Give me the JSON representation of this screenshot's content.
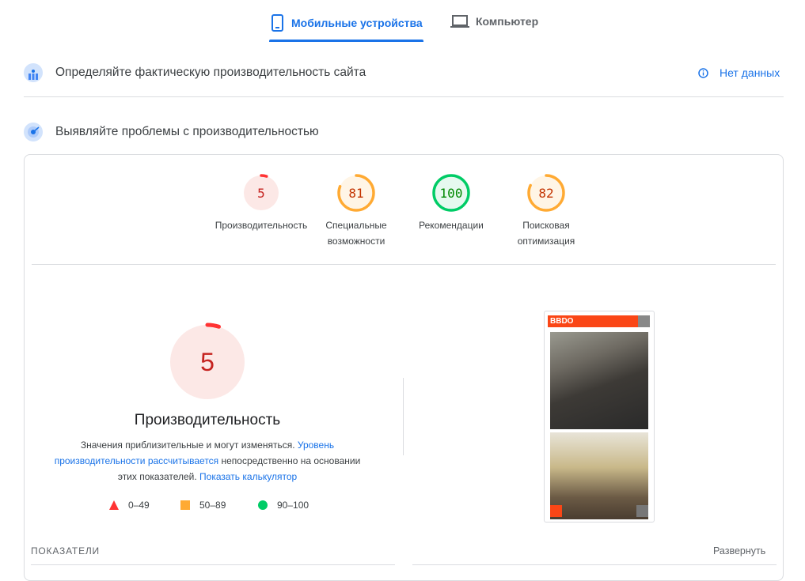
{
  "tabs": [
    {
      "label": "Мобильные устройства",
      "icon": "smartphone-icon"
    },
    {
      "label": "Компьютер",
      "icon": "laptop-icon"
    }
  ],
  "field_data": {
    "title": "Определяйте фактическую производительность сайта",
    "status": "Нет данных"
  },
  "lab": {
    "title": "Выявляйте проблемы с производительностью"
  },
  "scores": [
    {
      "value": "5",
      "label1": "Производительность",
      "label2": "",
      "score": 5,
      "color": "#ff3333",
      "fill": "#fce8e6",
      "text": "#c5221f"
    },
    {
      "value": "81",
      "label1": "Специальные",
      "label2": "возможности",
      "score": 81,
      "color": "#ffaa33",
      "fill": "#fff5e6",
      "text": "#c33300"
    },
    {
      "value": "100",
      "label1": "Рекомендации",
      "label2": "",
      "score": 100,
      "color": "#00cc66",
      "fill": "#e6f9ef",
      "text": "#008800"
    },
    {
      "value": "82",
      "label1": "Поисковая",
      "label2": "оптимизация",
      "score": 82,
      "color": "#ffaa33",
      "fill": "#fff5e6",
      "text": "#c33300"
    }
  ],
  "main": {
    "score": "5",
    "title": "Производительность",
    "desc1": "Значения приблизительные и могут изменяться. ",
    "link1": "Уровень производительности рассчитывается",
    "desc2": " непосредственно на основании этих показателей. ",
    "link2": "Показать калькулятор"
  },
  "legend": [
    "0–49",
    "50–89",
    "90–100"
  ],
  "screenshot": {
    "logo": "BBDO"
  },
  "metrics": {
    "title": "ПОКАЗАТЕЛИ",
    "expand": "Развернуть"
  }
}
